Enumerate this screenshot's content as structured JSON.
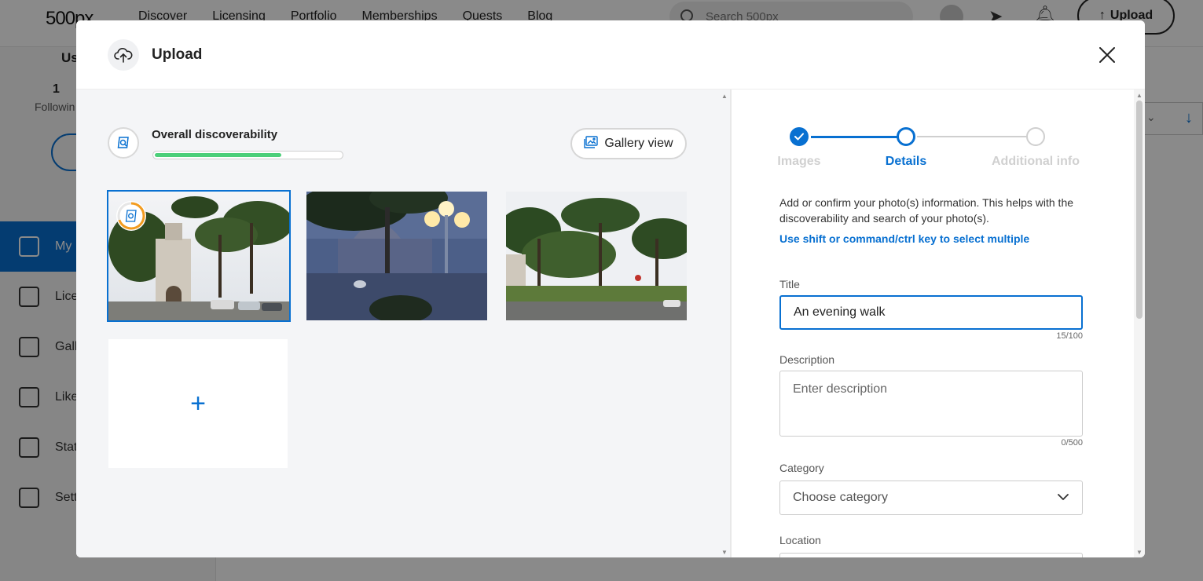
{
  "background": {
    "logo": "500px",
    "nav_links": [
      "Discover",
      "Licensing",
      "Portfolio",
      "Memberships",
      "Quests",
      "Blog"
    ],
    "search_placeholder": "Search 500px",
    "upload_label": "Upload",
    "sidebar": {
      "heading": "Us",
      "following_count": "1",
      "following_label": "Followin",
      "items": [
        {
          "label": "My",
          "icon": "image-icon",
          "active": true
        },
        {
          "label": "Lice",
          "icon": "crown-icon",
          "active": false
        },
        {
          "label": "Gall",
          "icon": "gallery-add-icon",
          "active": false
        },
        {
          "label": "Like",
          "icon": "heart-icon",
          "active": false
        },
        {
          "label": "Stat",
          "icon": "stats-icon",
          "active": false
        },
        {
          "label": "Sett",
          "icon": "gear-icon",
          "active": false
        }
      ]
    }
  },
  "modal": {
    "title": "Upload",
    "discoverability": {
      "label": "Overall discoverability",
      "progress_fraction": 0.68
    },
    "gallery_view_label": "Gallery view",
    "photos": [
      {
        "name": "photo-1",
        "selected": true
      },
      {
        "name": "photo-2",
        "selected": false
      },
      {
        "name": "photo-3",
        "selected": false
      }
    ],
    "add_photo_symbol": "+",
    "steps": [
      {
        "label": "Images",
        "state": "done"
      },
      {
        "label": "Details",
        "state": "current"
      },
      {
        "label": "Additional info",
        "state": "todo"
      }
    ],
    "info_text": "Add or confirm your photo(s) information. This helps with the discoverability and search of your photo(s).",
    "info_link": "Use shift or command/ctrl key to select multiple",
    "fields": {
      "title": {
        "label": "Title",
        "value": "An evening walk",
        "counter": "15/100"
      },
      "description": {
        "label": "Description",
        "placeholder": "Enter description",
        "counter": "0/500"
      },
      "category": {
        "label": "Category",
        "value": "Choose category"
      },
      "location": {
        "label": "Location"
      }
    }
  },
  "colors": {
    "accent": "#0870d1",
    "progress": "#4ccf7a",
    "muted_step": "#d0d0d0"
  }
}
